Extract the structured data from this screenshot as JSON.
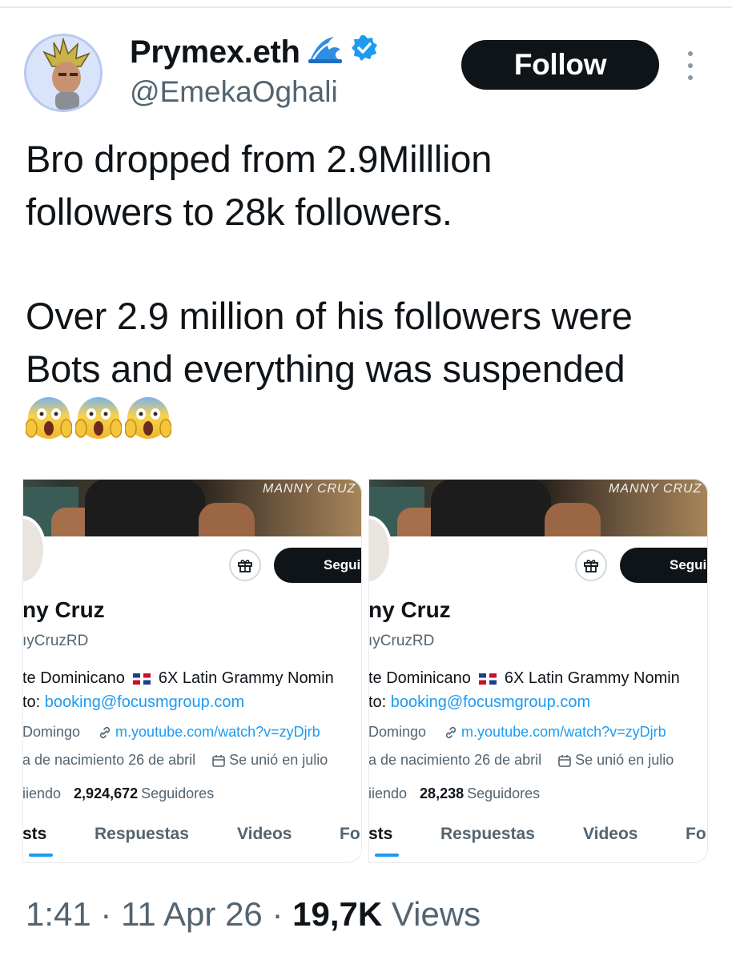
{
  "tweet": {
    "display_name": "Prymex.eth",
    "handle": "@EmekaOghali",
    "follow_label": "Follow",
    "text_line1": "Bro dropped from 2.9Milllion",
    "text_line2": "followers to 28k followers.",
    "text_line3": "Over 2.9 million of his followers were",
    "text_line4": "Bots and everything was suspended",
    "emoji_icon": "screaming-face-icon",
    "time": "1:41",
    "date": "11 Apr 26",
    "views_count": "19,7K",
    "views_label": "Views",
    "sep1": "·",
    "sep2": "·"
  },
  "panels": [
    {
      "banner_text": "MANNY CRUZ",
      "follow_label": "Segui",
      "name": "ny Cruz",
      "handle": "ıyCruzRD",
      "bio1_a": "te Dominicano",
      "bio1_b": "6X Latin Grammy Nomin",
      "bio2_a": "to: ",
      "bio2_link": "booking@focusmgroup.com",
      "location": "Domingo",
      "url": "m.youtube.com/watch?v=zyDjrb",
      "birth": "a de nacimiento 26 de abril",
      "joined": "Se unió en julio",
      "following_label": "iiendo",
      "followers_count": "2,924,672",
      "followers_label": "Seguidores",
      "tabs": [
        "sts",
        "Respuestas",
        "Videos",
        "Fo"
      ]
    },
    {
      "banner_text": "MANNY CRUZ",
      "follow_label": "Segui",
      "name": "ny Cruz",
      "handle": "ıyCruzRD",
      "bio1_a": "te Dominicano",
      "bio1_b": "6X Latin Grammy Nomin",
      "bio2_a": "to: ",
      "bio2_link": "booking@focusmgroup.com",
      "location": "Domingo",
      "url": "m.youtube.com/watch?v=zyDjrb",
      "birth": "a de nacimiento 26 de abril",
      "joined": "Se unió en julio",
      "following_label": "iiendo",
      "followers_count": "28,238",
      "followers_label": "Seguidores",
      "tabs": [
        "sts",
        "Respuestas",
        "Videos",
        "Fo"
      ]
    }
  ],
  "colors": {
    "accent": "#1d9bf0",
    "text": "#0f1419",
    "muted": "#536471",
    "verified": "#1d9bf0",
    "button_bg": "#0f1419"
  },
  "icons": {
    "wave": "water-wave-icon",
    "verified": "verified-badge-icon",
    "more": "more-vertical-icon",
    "gift": "gift-icon",
    "link": "link-icon",
    "calendar": "calendar-icon",
    "flag": "dominican-flag-icon"
  }
}
